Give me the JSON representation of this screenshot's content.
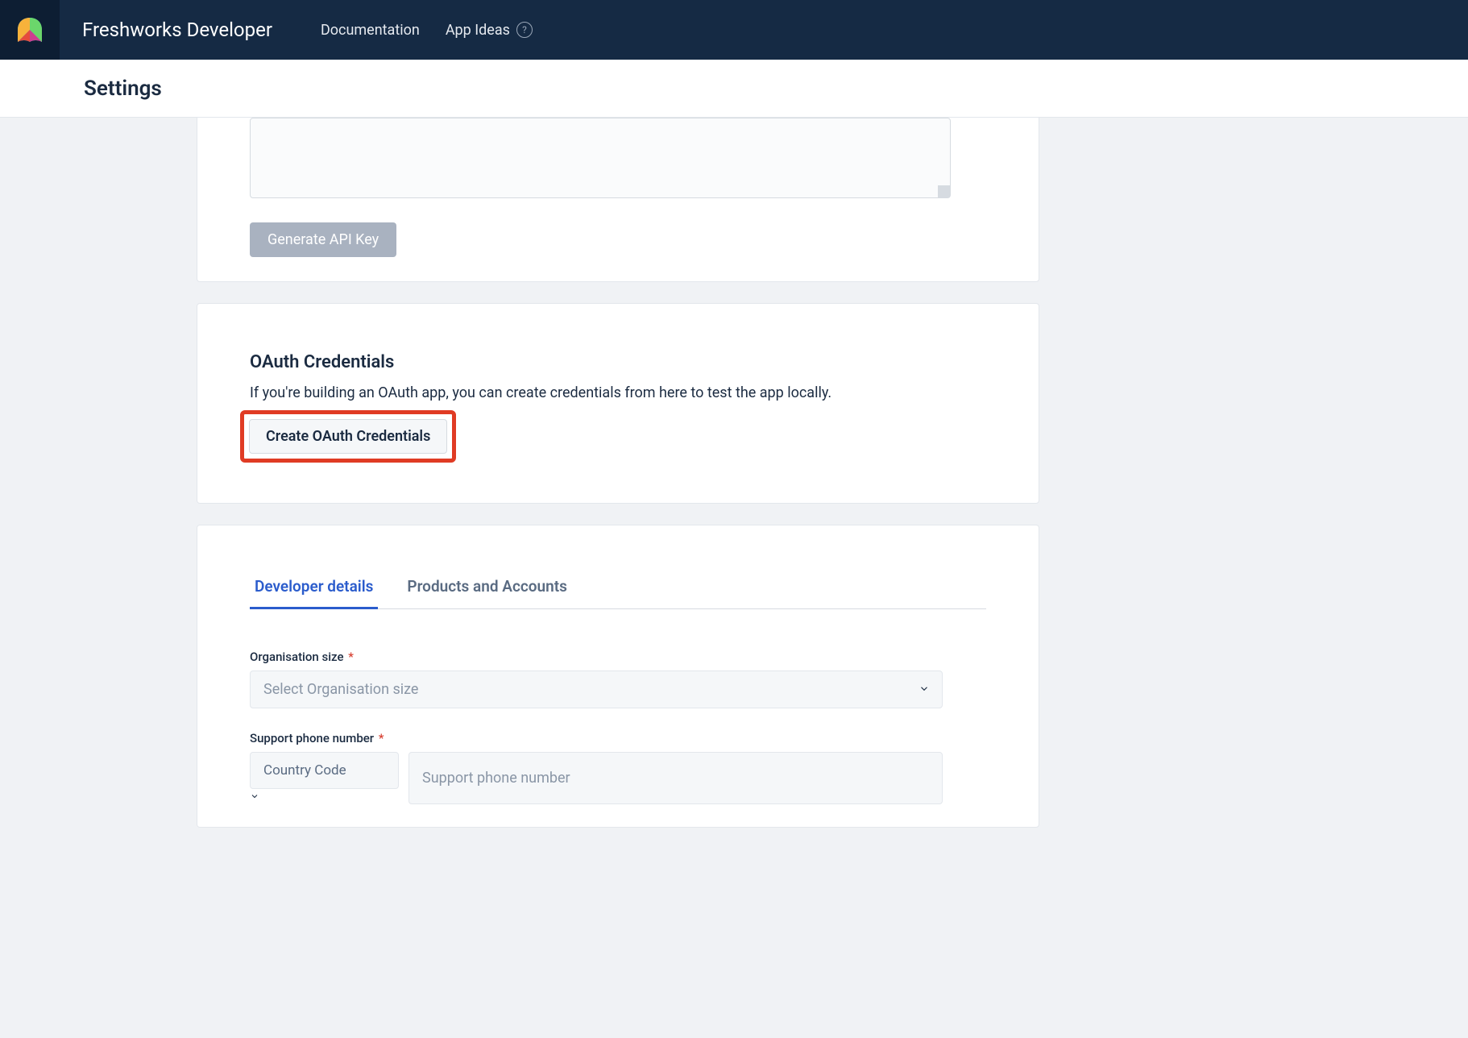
{
  "header": {
    "brand": "Freshworks Developer",
    "nav": {
      "documentation": "Documentation",
      "app_ideas": "App Ideas"
    }
  },
  "subheader": {
    "title": "Settings"
  },
  "api_section": {
    "generate_button": "Generate API Key"
  },
  "oauth_section": {
    "title": "OAuth Credentials",
    "description": "If you're building an OAuth app, you can create credentials from here to test the app locally.",
    "create_button": "Create OAuth Credentials"
  },
  "details_section": {
    "tabs": {
      "developer": "Developer details",
      "products": "Products and Accounts"
    },
    "org_size_label": "Organisation size",
    "org_size_placeholder": "Select Organisation size",
    "support_phone_label": "Support phone number",
    "country_code_placeholder": "Country Code",
    "support_phone_placeholder": "Support phone number"
  }
}
